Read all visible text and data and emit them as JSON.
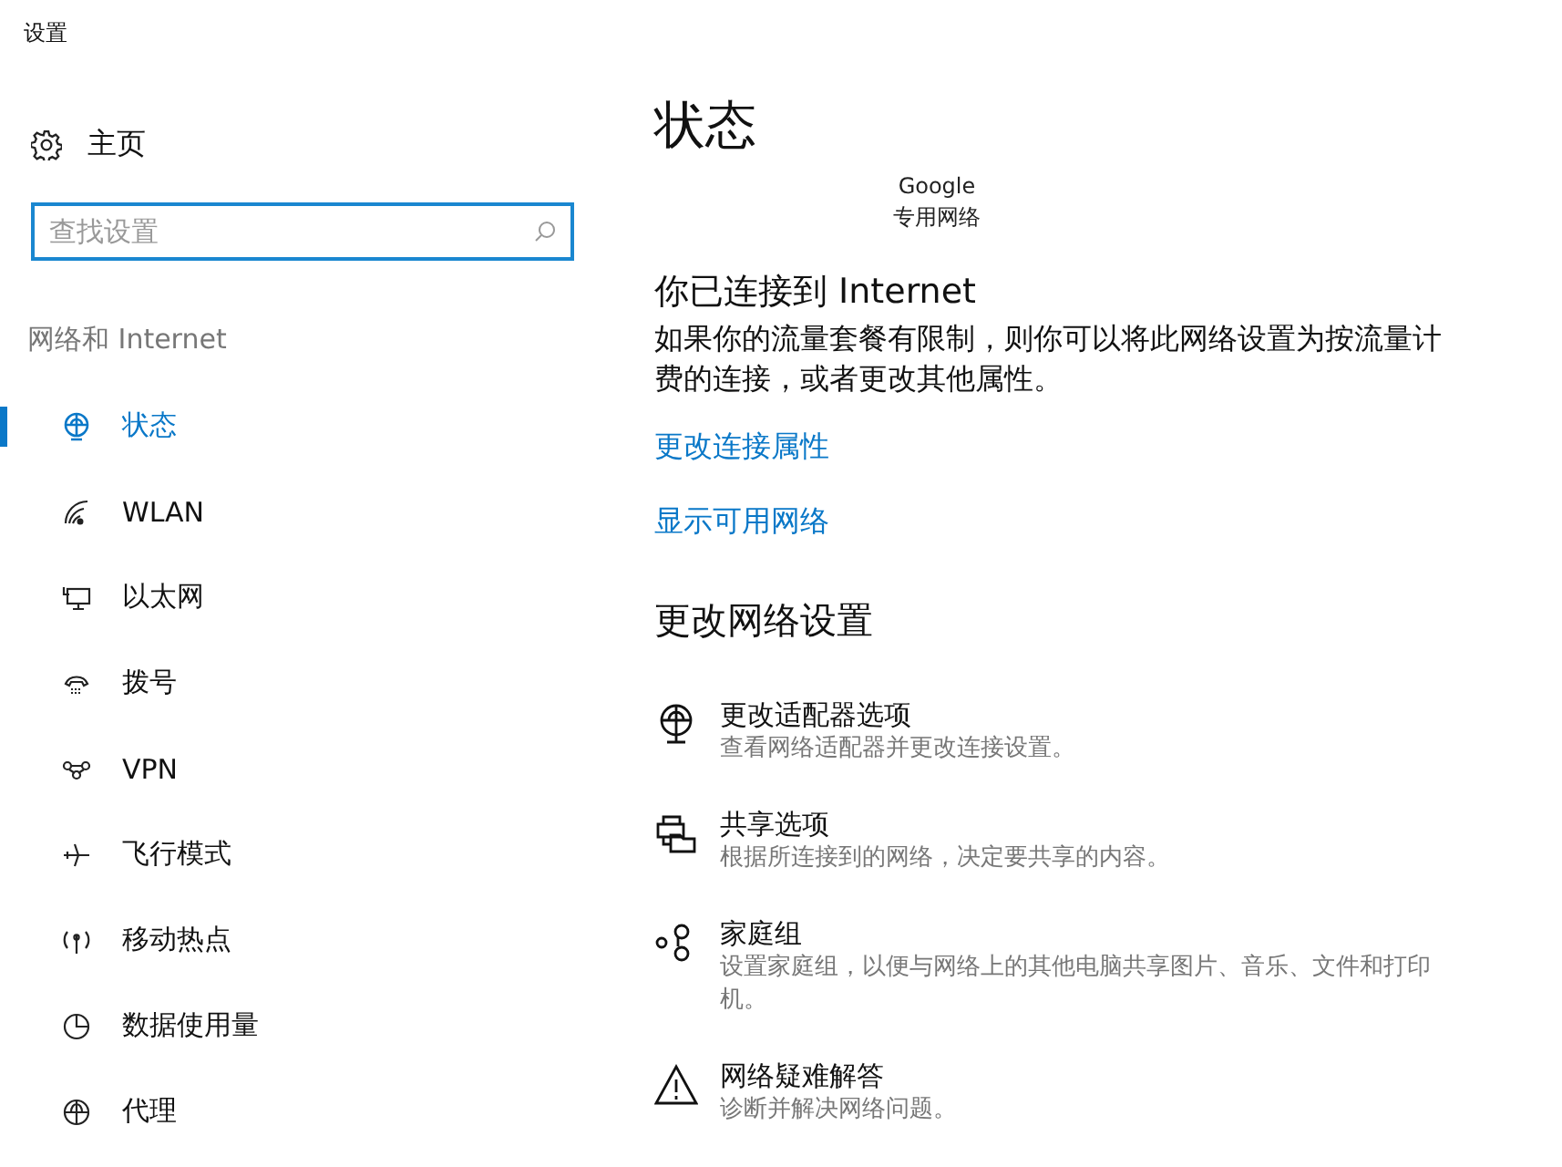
{
  "window": {
    "title": "设置"
  },
  "home": {
    "label": "主页"
  },
  "search": {
    "placeholder": "查找设置"
  },
  "section_label": "网络和 Internet",
  "nav": [
    {
      "kind": "status",
      "label": "状态",
      "selected": true
    },
    {
      "kind": "wlan",
      "label": "WLAN",
      "selected": false
    },
    {
      "kind": "ethernet",
      "label": "以太网",
      "selected": false
    },
    {
      "kind": "dialup",
      "label": "拨号",
      "selected": false
    },
    {
      "kind": "vpn",
      "label": "VPN",
      "selected": false
    },
    {
      "kind": "airplane",
      "label": "飞行模式",
      "selected": false
    },
    {
      "kind": "hotspot",
      "label": "移动热点",
      "selected": false
    },
    {
      "kind": "data",
      "label": "数据使用量",
      "selected": false
    },
    {
      "kind": "proxy",
      "label": "代理",
      "selected": false
    }
  ],
  "page_title": "状态",
  "network": {
    "name": "Google",
    "type": "专用网络"
  },
  "connection": {
    "heading": "你已连接到 Internet",
    "text": "如果你的流量套餐有限制，则你可以将此网络设置为按流量计费的连接，或者更改其他属性。"
  },
  "links": [
    "更改连接属性",
    "显示可用网络"
  ],
  "change_heading": "更改网络设置",
  "options": [
    {
      "kind": "adapter",
      "title": "更改适配器选项",
      "desc": "查看网络适配器并更改连接设置。"
    },
    {
      "kind": "sharing",
      "title": "共享选项",
      "desc": "根据所连接到的网络，决定要共享的内容。"
    },
    {
      "kind": "homegroup",
      "title": "家庭组",
      "desc": "设置家庭组，以便与网络上的其他电脑共享图片、音乐、文件和打印机。"
    },
    {
      "kind": "troubleshoot",
      "title": "网络疑难解答",
      "desc": "诊断并解决网络问题。"
    }
  ]
}
